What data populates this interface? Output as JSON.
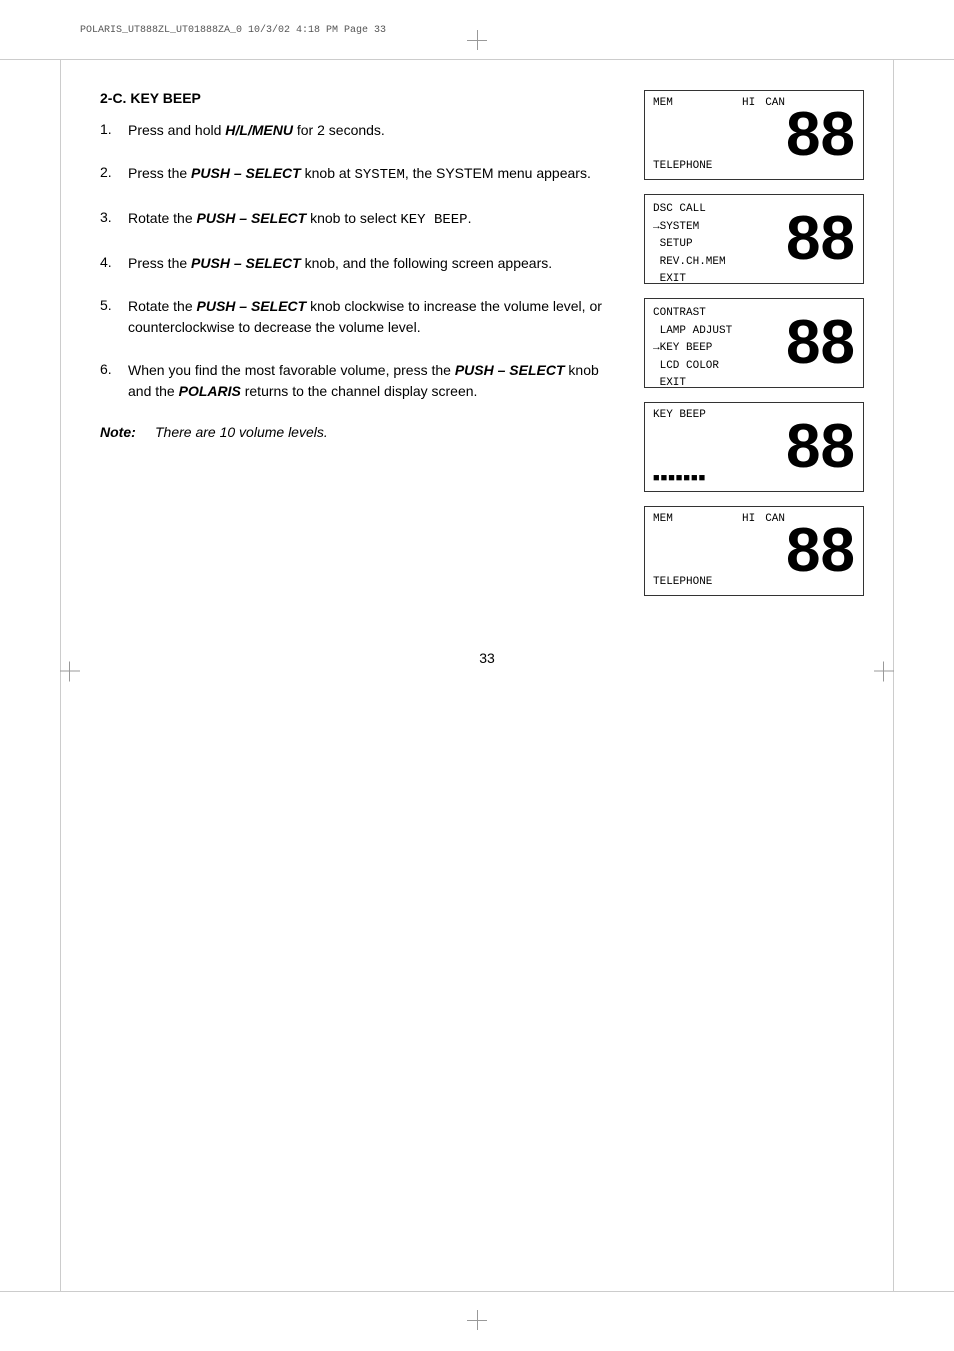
{
  "header": {
    "print_info": "POLARIS_UT888ZL_UT01888ZA_0   10/3/02   4:18 PM   Page 33"
  },
  "section": {
    "title": "2-C. KEY BEEP",
    "steps": [
      {
        "number": "1.",
        "text_parts": [
          {
            "type": "normal",
            "text": "Press and hold "
          },
          {
            "type": "bold_italic",
            "text": "H/L/MENU"
          },
          {
            "type": "normal",
            "text": " for 2 seconds."
          }
        ]
      },
      {
        "number": "2.",
        "text_parts": [
          {
            "type": "normal",
            "text": "Press the "
          },
          {
            "type": "bold_italic",
            "text": "PUSH – SELECT"
          },
          {
            "type": "normal",
            "text": " knob at "
          },
          {
            "type": "mono",
            "text": "SYSTEM"
          },
          {
            "type": "normal",
            "text": ", the SYSTEM menu appears."
          }
        ]
      },
      {
        "number": "3.",
        "text_parts": [
          {
            "type": "normal",
            "text": "Rotate the "
          },
          {
            "type": "bold_italic",
            "text": "PUSH – SELECT"
          },
          {
            "type": "normal",
            "text": " knob to select "
          },
          {
            "type": "mono",
            "text": "KEY BEEP"
          },
          {
            "type": "normal",
            "text": "."
          }
        ]
      },
      {
        "number": "4.",
        "text_parts": [
          {
            "type": "normal",
            "text": "Press the "
          },
          {
            "type": "bold_italic",
            "text": "PUSH – SELECT"
          },
          {
            "type": "normal",
            "text": " knob, and the following screen appears."
          }
        ]
      },
      {
        "number": "5.",
        "text_parts": [
          {
            "type": "normal",
            "text": "Rotate the "
          },
          {
            "type": "bold_italic",
            "text": "PUSH – SELECT"
          },
          {
            "type": "normal",
            "text": " knob clockwise to increase the volume level, or counterclockwise to decrease the volume level."
          }
        ]
      },
      {
        "number": "6.",
        "text_parts": [
          {
            "type": "normal",
            "text": "When you find the most favorable volume, press the "
          },
          {
            "type": "bold_italic",
            "text": "PUSH – SELECT"
          },
          {
            "type": "normal",
            "text": " knob and the "
          },
          {
            "type": "bold",
            "text": "POLARIS"
          },
          {
            "type": "normal",
            "text": " returns to the channel display screen."
          }
        ]
      }
    ],
    "note": {
      "label": "Note:",
      "text": "There are 10 volume levels."
    }
  },
  "displays": [
    {
      "id": "display1",
      "type": "channel",
      "top_left": "MEM",
      "top_center": "HI",
      "top_right": "CAN",
      "big_number": "88",
      "bottom": "TELEPHONE"
    },
    {
      "id": "display2",
      "type": "menu",
      "lines": "DSC CALL\n→SYSTEM\n SETUP\n REV.CH.MEM\n EXIT",
      "big_number": "88"
    },
    {
      "id": "display3",
      "type": "menu",
      "lines": "CONTRAST\n LAMP ADJUST\n→KEY BEEP\n LCD COLOR\n EXIT",
      "big_number": "88"
    },
    {
      "id": "display4",
      "type": "key_beep",
      "top": "KEY BEEP",
      "volume_bar": "▪▪▪▪▪▪▪",
      "big_number": "88"
    },
    {
      "id": "display5",
      "type": "channel",
      "top_left": "MEM",
      "top_center": "HI",
      "top_right": "CAN",
      "big_number": "88",
      "bottom": "TELEPHONE"
    }
  ],
  "page_number": "33"
}
